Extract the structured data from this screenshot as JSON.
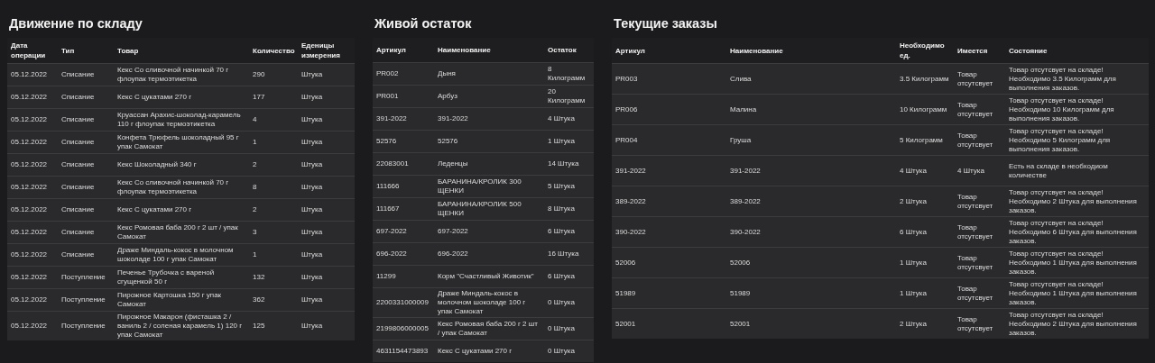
{
  "panels": [
    {
      "title": "Движение по складу",
      "columns": [
        "Дата операции",
        "Тип",
        "Товар",
        "Количество",
        "Еденицы измерения"
      ],
      "rows": [
        [
          "05.12.2022",
          "Списание",
          "Кекс Со сливочной начинкой 70 г флоупак термоэтикетка",
          "290",
          "Штука"
        ],
        [
          "05.12.2022",
          "Списание",
          "Кекс С цукатами 270 г",
          "177",
          "Штука"
        ],
        [
          "05.12.2022",
          "Списание",
          "Круассан Арахис-шоколад-карамель 110 г флоупак термоэтикетка",
          "4",
          "Штука"
        ],
        [
          "05.12.2022",
          "Списание",
          "Конфета Трюфель шоколадный 95 г упак Самокат",
          "1",
          "Штука"
        ],
        [
          "05.12.2022",
          "Списание",
          "Кекс Шоколадный 340 г",
          "2",
          "Штука"
        ],
        [
          "05.12.2022",
          "Списание",
          "Кекс Со сливочной начинкой 70 г флоупак термоэтикетка",
          "8",
          "Штука"
        ],
        [
          "05.12.2022",
          "Списание",
          "Кекс С цукатами 270 г",
          "2",
          "Штука"
        ],
        [
          "05.12.2022",
          "Списание",
          "Кекс Ромовая баба 200 г 2 шт / упак Самокат",
          "3",
          "Штука"
        ],
        [
          "05.12.2022",
          "Списание",
          "Драже Миндаль-кокос в молочном шоколаде 100 г упак Самокат",
          "1",
          "Штука"
        ],
        [
          "05.12.2022",
          "Поступление",
          "Печенье Трубочка с вареной сгущенкой 50 г",
          "132",
          "Штука"
        ],
        [
          "05.12.2022",
          "Поступление",
          "Пирожное Картошка 150 г упак Самокат",
          "362",
          "Штука"
        ],
        [
          "05.12.2022",
          "Поступление",
          "Пирожное Макарон (фисташка 2 / ваниль 2 / соленая карамель 1) 120 г упак Самокат",
          "125",
          "Штука"
        ]
      ]
    },
    {
      "title": "Живой остаток",
      "columns": [
        "Артикул",
        "Наименование",
        "Остаток"
      ],
      "rows": [
        [
          "PR002",
          "Дыня",
          "8 Килограмм"
        ],
        [
          "PR001",
          "Арбуз",
          "20 Килограмм"
        ],
        [
          "391-2022",
          "391-2022",
          "4 Штука"
        ],
        [
          "52576",
          "52576",
          "1 Штука"
        ],
        [
          "22083001",
          "Леденцы",
          "14 Штука"
        ],
        [
          "111666",
          "БАРАНИНА/КРОЛИК 300 ЩЕНКИ",
          "5 Штука"
        ],
        [
          "111667",
          "БАРАНИНА/КРОЛИК 500 ЩЕНКИ",
          "8 Штука"
        ],
        [
          "697-2022",
          "697-2022",
          "6 Штука"
        ],
        [
          "696-2022",
          "696-2022",
          "16 Штука"
        ],
        [
          "11299",
          "Корм \"Счастливый Животик\"",
          "6 Штука"
        ],
        [
          "2200331000009",
          "Драже Миндаль-кокос в молочном шоколаде 100 г упак Самокат",
          "0 Штука"
        ],
        [
          "2199806000005",
          "Кекс Ромовая баба 200 г 2 шт / упак Самокат",
          "0 Штука"
        ],
        [
          "4631154473893",
          "Кекс С цукатами 270 г",
          "0 Штука"
        ]
      ]
    },
    {
      "title": "Текущие заказы",
      "columns": [
        "Артикул",
        "Наименование",
        "Необходимо ед.",
        "Имеется",
        "Состояние"
      ],
      "rows": [
        [
          "PR003",
          "Слива",
          "3.5 Килограмм",
          "Товар отсутсвует",
          "Товар отсутсвует на складе! Необходимо 3.5 Килограмм для выполнения заказов."
        ],
        [
          "PR006",
          "Малина",
          "10 Килограмм",
          "Товар отсутсвует",
          "Товар отсутсвует на складе! Необходимо 10 Килограмм для выполнения заказов."
        ],
        [
          "PR004",
          "Груша",
          "5 Килограмм",
          "Товар отсутсвует",
          "Товар отсутсвует на складе! Необходимо 5 Килограмм для выполнения заказов."
        ],
        [
          "391-2022",
          "391-2022",
          "4 Штука",
          "4 Штука",
          "Есть на складе в необходиом количестве"
        ],
        [
          "389-2022",
          "389-2022",
          "2 Штука",
          "Товар отсутсвует",
          "Товар отсутсвует на складе! Необходимо 2 Штука для выполнения заказов."
        ],
        [
          "390-2022",
          "390-2022",
          "6 Штука",
          "Товар отсутсвует",
          "Товар отсутсвует на складе! Необходимо 6 Штука для выполнения заказов."
        ],
        [
          "52006",
          "52006",
          "1 Штука",
          "Товар отсутсвует",
          "Товар отсутсвует на складе! Необходимо 1 Штука для выполнения заказов."
        ],
        [
          "51989",
          "51989",
          "1 Штука",
          "Товар отсутсвует",
          "Товар отсутсвует на складе! Необходимо 1 Штука для выполнения заказов."
        ],
        [
          "52001",
          "52001",
          "2 Штука",
          "Товар отсутсвует",
          "Товар отсутсвует на складе! Необходимо 2 Штука для выполнения заказов."
        ]
      ]
    }
  ]
}
